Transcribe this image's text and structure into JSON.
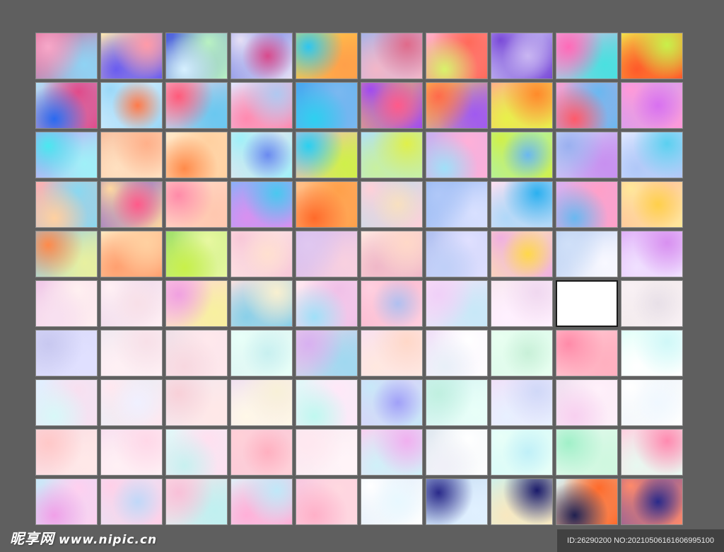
{
  "watermark": {
    "logo_text": "昵享网",
    "url": "www.nipic.cn"
  },
  "image_id": "ID:26290200 NO:20210506161606995100",
  "grid": {
    "rows": 10,
    "cols": 10,
    "selected_index": 58
  },
  "swatch_palettes": [
    [
      "#f7a8c9",
      "#8fd3f4",
      "#e05a8a"
    ],
    [
      "#ff9aa8",
      "#6a5cf0",
      "#ffe9b0"
    ],
    [
      "#d6f0ff",
      "#b9f2c2",
      "#4a5ce0"
    ],
    [
      "#d84a8c",
      "#e6e0f5",
      "#5b6de0"
    ],
    [
      "#2ec6f0",
      "#ffa04a",
      "#ffd84a"
    ],
    [
      "#e06a8a",
      "#f2b6c8",
      "#a7b4e8"
    ],
    [
      "#d8f26a",
      "#ff6a5a",
      "#ffb0c8"
    ],
    [
      "#c9b6f2",
      "#7a4ad8",
      "#e8f0ff"
    ],
    [
      "#ff6ab8",
      "#4ae0e0",
      "#f2b0e0"
    ],
    [
      "#c8f04a",
      "#ff5a2a",
      "#f2e04a"
    ],
    [
      "#2a6af0",
      "#e04a8a",
      "#b0e0f8"
    ],
    [
      "#ff7a4a",
      "#9ad8f8",
      "#e8f4ff"
    ],
    [
      "#ff5a7a",
      "#6ac8f0",
      "#f8d0e0"
    ],
    [
      "#b0c8f0",
      "#ff8ab0",
      "#dfe8ff"
    ],
    [
      "#2ed0f0",
      "#7ab8f0",
      "#48a8f0"
    ],
    [
      "#ff5a8a",
      "#a04af0",
      "#ffd04a"
    ],
    [
      "#ff6a4a",
      "#a05af0",
      "#ffe04a"
    ],
    [
      "#ff8a2a",
      "#e8f04a",
      "#ffb08a"
    ],
    [
      "#ff5a6a",
      "#6ab8f0",
      "#f8a0d0"
    ],
    [
      "#d870f0",
      "#ff9ad8",
      "#c0a0f8"
    ],
    [
      "#4ae8f0",
      "#a0f0f8",
      "#c890f0"
    ],
    [
      "#ffb08a",
      "#ffe0c0",
      "#f8c0a0"
    ],
    [
      "#ff8a4a",
      "#ffd0a0",
      "#ffe8c8"
    ],
    [
      "#6a8af0",
      "#a0f0f8",
      "#ffe0e8"
    ],
    [
      "#2ad0f0",
      "#d0f04a",
      "#f8b0d8"
    ],
    [
      "#e0f04a",
      "#c8f0a0",
      "#b0e0f8"
    ],
    [
      "#a0e0f8",
      "#ffb0d8",
      "#c8b0f0"
    ],
    [
      "#6ab8f0",
      "#d0f04a",
      "#a0f0d0"
    ],
    [
      "#9ab0f0",
      "#c890f0",
      "#d0e0f8"
    ],
    [
      "#5ad0f0",
      "#b0c8f8",
      "#e0e8ff"
    ],
    [
      "#ffd0a0",
      "#8ad8f0",
      "#ffb0b0"
    ],
    [
      "#ff5a8a",
      "#ffd8a0",
      "#6a4ad8"
    ],
    [
      "#ff8aa8",
      "#ffc8b0",
      "#ffe0d0"
    ],
    [
      "#4ac8f0",
      "#d890f0",
      "#8ab0f8"
    ],
    [
      "#ff6a2a",
      "#ffa04a",
      "#ffc08a"
    ],
    [
      "#f8e0c0",
      "#ffd0d8",
      "#b0e0f0"
    ],
    [
      "#b0c8f8",
      "#d8e0ff",
      "#8ab0f0"
    ],
    [
      "#2ab0f0",
      "#b0d8f8",
      "#ffe0f0"
    ],
    [
      "#6ab8f0",
      "#ffa0c8",
      "#d8b0f0"
    ],
    [
      "#ffd04a",
      "#ffe89a",
      "#ffb0a0"
    ],
    [
      "#ff8a4a",
      "#e8f0a0",
      "#8ac8f0"
    ],
    [
      "#ffd0a0",
      "#ffa070",
      "#ffe8c0"
    ],
    [
      "#c8f04a",
      "#e8f8a0",
      "#a0e06a"
    ],
    [
      "#ffe0d0",
      "#f8c8d8",
      "#fff0e8"
    ],
    [
      "#e0c8f0",
      "#f8d0e0",
      "#d0b8f0"
    ],
    [
      "#ffd8c8",
      "#f0b8c8",
      "#ffe8e0"
    ],
    [
      "#c0d0f8",
      "#e0e0ff",
      "#b0c0f0"
    ],
    [
      "#ffd84a",
      "#f0b0e0",
      "#fff0a0"
    ],
    [
      "#d0e0f8",
      "#f8f8ff",
      "#b0c8f0"
    ],
    [
      "#d890f0",
      "#f0e0ff",
      "#e0b0f8"
    ],
    [
      "#f8e0f0",
      "#fff0f0",
      "#f0c8e8"
    ],
    [
      "#f8e0e8",
      "#fff0f4",
      "#e8d0e8"
    ],
    [
      "#f0a0e0",
      "#f8f0a0",
      "#ffd0e8"
    ],
    [
      "#f8f0d0",
      "#8ad0e8",
      "#f8e0e0"
    ],
    [
      "#a0e0f8",
      "#f0c0e8",
      "#ffe8f0"
    ],
    [
      "#b0c0f0",
      "#ffd0e0",
      "#f8b0c8"
    ],
    [
      "#f0d0f8",
      "#c8e8f8",
      "#ffe0f8"
    ],
    [
      "#f0d8f0",
      "#fff0ff",
      "#f8e8f0"
    ],
    [
      "#ffffff",
      "#ffffff",
      "#ffffff"
    ],
    [
      "#e8e0e8",
      "#f8f0f4",
      "#f0e8e8"
    ],
    [
      "#c8c8f0",
      "#e0e0ff",
      "#d8d8f8"
    ],
    [
      "#f8e0e8",
      "#fff0f4",
      "#f0e8f0"
    ],
    [
      "#f8d8e0",
      "#ffe8ec",
      "#f0e0e8"
    ],
    [
      "#c8f0f0",
      "#e8fff8",
      "#d8f0f0"
    ],
    [
      "#d8b0f0",
      "#a0d8f0",
      "#f0d0e8"
    ],
    [
      "#ffd8c8",
      "#ffe8e0",
      "#f8e0f0"
    ],
    [
      "#e8f0f8",
      "#ffffff",
      "#f0e0f8"
    ],
    [
      "#c8f0d8",
      "#e8fff0",
      "#d8f8e8"
    ],
    [
      "#ff8aa8",
      "#ffb0c0",
      "#ffd0d8"
    ],
    [
      "#d0f8f8",
      "#ffffff",
      "#e0fff8"
    ],
    [
      "#d8f8f8",
      "#f8e0f0",
      "#e0f0ff"
    ],
    [
      "#f0f0ff",
      "#ffe8f0",
      "#e0f0f8"
    ],
    [
      "#f8d0d8",
      "#ffe8e8",
      "#f0e8f0"
    ],
    [
      "#f8f0d8",
      "#fff8e8",
      "#f0e0f0"
    ],
    [
      "#c0f8f0",
      "#ffe8f8",
      "#e0f8f8"
    ],
    [
      "#a0a0f8",
      "#c8e8f8",
      "#e0c8f8"
    ],
    [
      "#c0f0e0",
      "#e8fff8",
      "#d0f0f0"
    ],
    [
      "#d0d8f8",
      "#e8f0ff",
      "#f0e0f8"
    ],
    [
      "#f8d0f0",
      "#fff0fa",
      "#f0e0f0"
    ],
    [
      "#f0f8ff",
      "#ffffff",
      "#e8f0f8"
    ],
    [
      "#ffc8c8",
      "#ffe8e8",
      "#f8d8e0"
    ],
    [
      "#ffd8e8",
      "#fff0f4",
      "#f8e0f0"
    ],
    [
      "#c8f0f0",
      "#ffe0f0",
      "#e0f8f8"
    ],
    [
      "#ffb0c0",
      "#ffd0d8",
      "#f8c8d8"
    ],
    [
      "#ffe8f0",
      "#fff4f8",
      "#f8e8f0"
    ],
    [
      "#f0b0f0",
      "#d0f0f8",
      "#f8d0f0"
    ],
    [
      "#f0f0f8",
      "#ffffff",
      "#e0e8f0"
    ],
    [
      "#c0f0f8",
      "#e8fff8",
      "#d0f8f8"
    ],
    [
      "#a0f0c8",
      "#d0f8e0",
      "#e8f8f0"
    ],
    [
      "#ff8ab0",
      "#e8f8f0",
      "#ffd0e0"
    ],
    [
      "#f0a0e8",
      "#ffd0f0",
      "#c8e8f8"
    ],
    [
      "#c0d8f8",
      "#ffd0e8",
      "#e0e8f8"
    ],
    [
      "#f8c0d8",
      "#c0f0f0",
      "#ffe0e8"
    ],
    [
      "#c0e8f8",
      "#ffb0d8",
      "#e0f0f8"
    ],
    [
      "#ffb0c8",
      "#ffd8e0",
      "#f8c8e0"
    ],
    [
      "#e8f8ff",
      "#ffffff",
      "#d8e8f8"
    ],
    [
      "#2a2a8a",
      "#e0f0ff",
      "#c0d8f0"
    ],
    [
      "#1a1a6a",
      "#f8e8c0",
      "#d0f0e8"
    ],
    [
      "#202050",
      "#ff6a2a",
      "#d8f0f0"
    ],
    [
      "#2a2a8a",
      "#ff8a6a",
      "#5a4ab0"
    ]
  ]
}
